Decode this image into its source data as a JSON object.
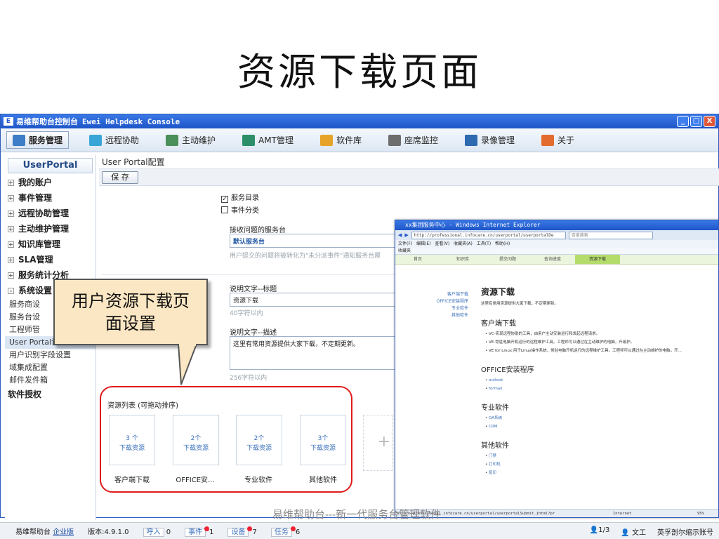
{
  "slide": {
    "title": "资源下载页面",
    "footer": "易维帮助台---新一代服务台管理软件"
  },
  "window": {
    "title_prefix": "易维帮助台控制台",
    "title": "Ewei Helpdesk Console",
    "btn_min": "_",
    "btn_max": "□",
    "btn_close": "X"
  },
  "toolbar": {
    "items": [
      {
        "label": "服务管理",
        "color": "#3e7dc7"
      },
      {
        "label": "远程协助",
        "color": "#3aa6d8"
      },
      {
        "label": "主动维护",
        "color": "#4b8f5a"
      },
      {
        "label": "AMT管理",
        "color": "#2c8f6a"
      },
      {
        "label": "软件库",
        "color": "#e7a228"
      },
      {
        "label": "座席监控",
        "color": "#6d6d6d"
      },
      {
        "label": "录像管理",
        "color": "#2d6ab0"
      },
      {
        "label": "关于",
        "color": "#e46b2e"
      }
    ]
  },
  "sidebar": {
    "header": "UserPortal",
    "items": [
      "我的账户",
      "事件管理",
      "远程协助管理",
      "主动维护管理",
      "知识库管理",
      "SLA管理",
      "服务统计分析",
      "系统设置"
    ],
    "subitems": [
      "服务商设",
      "服务台设",
      "工程师管",
      "User Portal设置",
      "用户识别字段设置",
      "域集成配置",
      "邮件发件箱"
    ],
    "last": "软件授权"
  },
  "content": {
    "heading": "User Portal配置",
    "save": "保 存",
    "opt1": "服务目录",
    "opt2": "事件分类",
    "receive_label": "接收问题的服务台",
    "receive_value": "默认服务台",
    "receive_hint": "用户提交的问题将被转化为\"未分派事件\"通知服务台屋",
    "desc_title_label": "说明文字--标题",
    "desc_title_value": "资源下载",
    "desc_title_hint": "40字符以内",
    "desc_body_label": "说明文字--描述",
    "desc_body_value": "这里有常用资源提供大家下载，不定期更新。",
    "desc_body_hint": "256字符以内",
    "list_title": "资源列表 (可拖动排序)",
    "cards": [
      {
        "count": "3 个",
        "unit": "下载资源",
        "name": "客户端下载"
      },
      {
        "count": "2个",
        "unit": "下载资源",
        "name": "OFFICE安..."
      },
      {
        "count": "2个",
        "unit": "下载资源",
        "name": "专业软件"
      },
      {
        "count": "3个",
        "unit": "下载资源",
        "name": "其他软件"
      }
    ],
    "add": "+"
  },
  "callout": {
    "line1": "用户资源下载页",
    "line2": "面设置"
  },
  "statusbar": {
    "app": "易维帮助台",
    "edition": "企业版",
    "version": "版本:4.9.1.0",
    "call_label": "呼入",
    "call_count": "0",
    "event_label": "事件",
    "event_count": "1",
    "device_label": "设备",
    "device_count": "7",
    "task_label": "任务",
    "task_count": "6",
    "page": "1/3",
    "user": "文工",
    "account": "英孚剖尔缩示账号"
  },
  "ie": {
    "title": "xx集团服务中心 - Windows Internet Explorer",
    "url": "http://professional.infocare.cn/userportal/userportalDe",
    "search": "百度搜索",
    "menu": "文件(F) 编辑(E) 查看(V) 收藏夹(A) 工具(T) 帮助(H)",
    "fav": "收藏夹",
    "nav": [
      "首页",
      "知识库",
      "提交问题",
      "查询进度",
      "资源下载"
    ],
    "left": [
      "客户端下载",
      "OFFICE安装程序",
      "专业软件",
      "其他软件"
    ],
    "h1": "资源下载",
    "desc": "这里有常用资源提供大家下载，不定期更新。",
    "sec1": "客户端下载",
    "sec1_items": [
      "VC-实现远程协助的工具，由用户主动安装运行和发起远程请求。",
      "VE-常驻电脑开机运行的远程维护工具，工程师可以通过在主动维护的电脑，升级护。",
      "VE for Linux 用于Linux操作系统，常驻电脑开机运行的远程维护工具，工程师可以通过在主动维护的电脑，开..."
    ],
    "sec2": "OFFICE安装程序",
    "sec2_items": [
      "outlook",
      "formail"
    ],
    "sec3": "专业软件",
    "sec3_items": [
      "OA系统",
      "CRM"
    ],
    "sec4": "其他软件",
    "sec4_items": [
      "门禁",
      "打印机",
      "复印"
    ],
    "status": "http://professional.infocare.cn/userportal/userportalSubmit.jhtml?pr",
    "zone": "Internet",
    "zoom": "95%"
  }
}
